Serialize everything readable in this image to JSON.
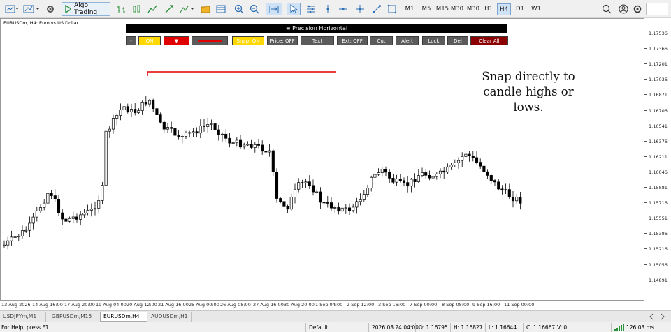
{
  "toolbar": {
    "algo_trading_label": "Algo Trading",
    "timeframes": [
      "M1",
      "M5",
      "M15",
      "M30",
      "H1",
      "H4",
      "D1",
      "W1"
    ],
    "active_timeframe": "H4"
  },
  "chart": {
    "title": "EURUSDm, H4:  Euro vs US Dollar",
    "price_levels": [
      "1.17536",
      "1.17366",
      "1.17201",
      "1.17036",
      "1.16871",
      "1.16706",
      "1.16541",
      "1.16376",
      "1.16211",
      "1.16046",
      "1.15881",
      "1.15716",
      "1.15551",
      "1.15386",
      "1.15216",
      "1.15056",
      "1.14891"
    ],
    "time_labels": [
      "13 Aug 2026",
      "14 Aug 16:00",
      "17 Aug 20:00",
      "19 Aug 04:00",
      "20 Aug 12:00",
      "21 Aug 16:00",
      "25 Aug 00:00",
      "26 Aug 08:00",
      "27 Aug 16:00",
      "30 Aug 20:00",
      "1 Sep 04:00",
      "2 Sep 12:00",
      "3 Sep 16:00",
      "7 Sep 00:00",
      "8 Sep 08:00",
      "9 Sep 16:00",
      "11 Sep 00:00"
    ],
    "annotation": "Snap directly to candle highs or lows.",
    "colors": {
      "up": "#ffffff",
      "down": "#000000",
      "line": "#e00000"
    }
  },
  "precision_panel": {
    "title": "≡ Precision Horizontal",
    "buttons": [
      {
        "label": "-",
        "bg": "#5b5b5b",
        "fg": "#ffffff"
      },
      {
        "label": "ON",
        "bg": "#ffd800",
        "fg": "#ffffff"
      },
      {
        "label": "▼",
        "bg": "#e00000",
        "fg": "#ffffff"
      },
      {
        "label": "",
        "bg": "#5b5b5b",
        "fg": "#ffffff"
      },
      {
        "label": "Snap: ON",
        "bg": "#ffd800",
        "fg": "#ffffff"
      },
      {
        "label": "Price: OFF",
        "bg": "#5b5b5b",
        "fg": "#ffffff"
      },
      {
        "label": "Text",
        "bg": "#5b5b5b",
        "fg": "#ffffff"
      },
      {
        "label": "Ext: OFF",
        "bg": "#5b5b5b",
        "fg": "#ffffff"
      },
      {
        "label": "Cut",
        "bg": "#5b5b5b",
        "fg": "#ffffff"
      },
      {
        "label": "Alert",
        "bg": "#5b5b5b",
        "fg": "#ffffff"
      },
      {
        "label": "Lock",
        "bg": "#5b5b5b",
        "fg": "#ffffff"
      },
      {
        "label": "Del",
        "bg": "#5b5b5b",
        "fg": "#ffffff"
      },
      {
        "label": "Clear All",
        "bg": "#8b0000",
        "fg": "#ffffff"
      }
    ]
  },
  "tabs": [
    {
      "label": "USDJPYm,M1",
      "active": false
    },
    {
      "label": "GBPUSDm,M15",
      "active": false
    },
    {
      "label": "EURUSDm,H4",
      "active": true
    },
    {
      "label": "AUDUSDm,H1",
      "active": false
    }
  ],
  "status": {
    "help": "For Help, press F1",
    "profile": "Default",
    "datetime": "2026.08.24 04:00",
    "open": "O: 1.16795",
    "high": "H: 1.16827",
    "low": "L: 1.16644",
    "close": "C: 1.16667",
    "volume": "V: 0",
    "traffic": "126.03 ms"
  }
}
